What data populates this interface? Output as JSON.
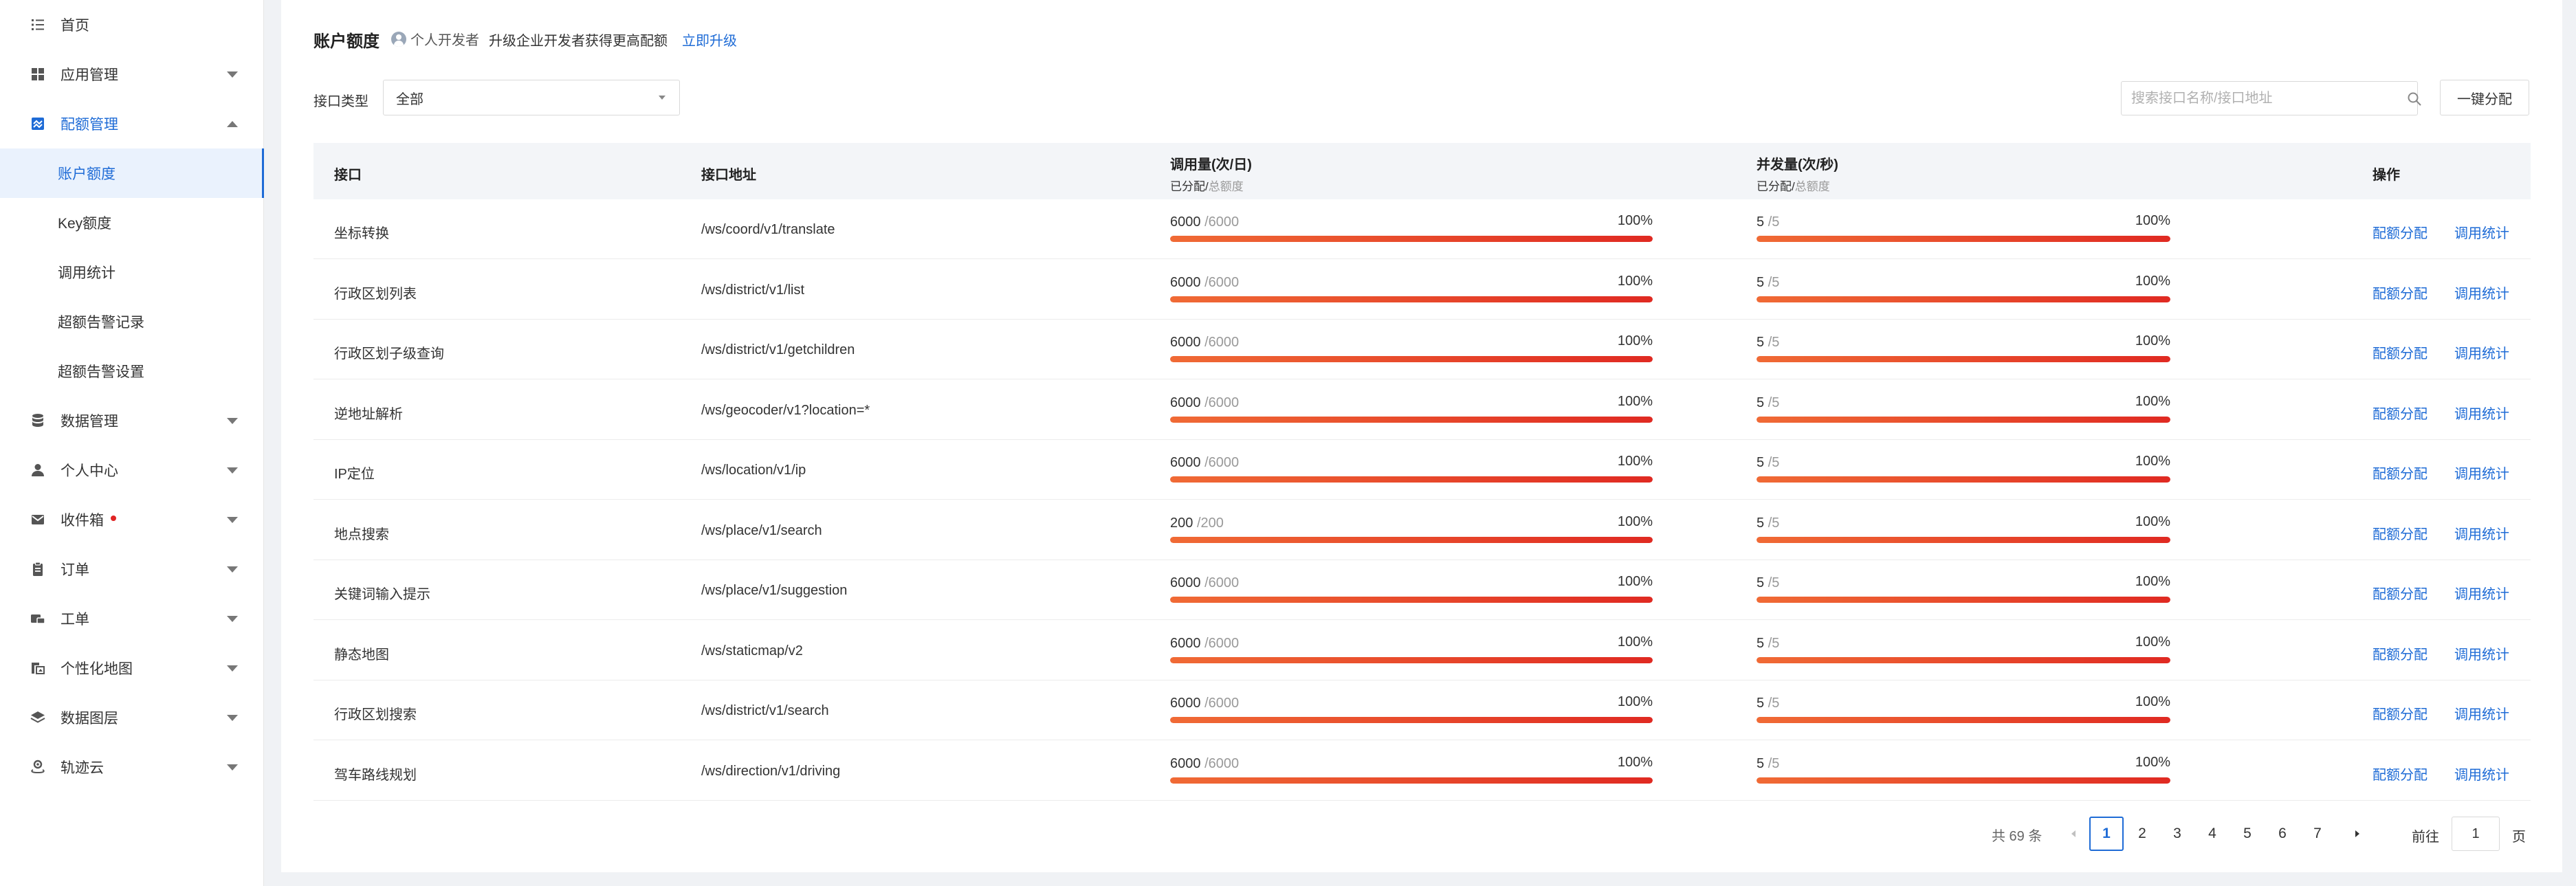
{
  "sidebar": {
    "items": [
      {
        "label": "首页",
        "icon": "list-icon",
        "arrow": "none",
        "state": "normal",
        "sub": false
      },
      {
        "label": "应用管理",
        "icon": "grid-icon",
        "arrow": "down",
        "state": "normal",
        "sub": false
      },
      {
        "label": "配额管理",
        "icon": "quota-icon",
        "arrow": "up",
        "state": "open",
        "sub": false
      },
      {
        "label": "账户额度",
        "icon": "",
        "arrow": "none",
        "state": "active",
        "sub": true
      },
      {
        "label": "Key额度",
        "icon": "",
        "arrow": "none",
        "state": "normal",
        "sub": true
      },
      {
        "label": "调用统计",
        "icon": "",
        "arrow": "none",
        "state": "normal",
        "sub": true
      },
      {
        "label": "超额告警记录",
        "icon": "",
        "arrow": "none",
        "state": "normal",
        "sub": true
      },
      {
        "label": "超额告警设置",
        "icon": "",
        "arrow": "none",
        "state": "normal",
        "sub": true
      },
      {
        "label": "数据管理",
        "icon": "database-icon",
        "arrow": "down",
        "state": "normal",
        "sub": false
      },
      {
        "label": "个人中心",
        "icon": "user-icon",
        "arrow": "down",
        "state": "normal",
        "sub": false
      },
      {
        "label": "收件箱",
        "icon": "mail-icon",
        "arrow": "down",
        "state": "normal",
        "sub": false,
        "dot": true
      },
      {
        "label": "订单",
        "icon": "clipboard-icon",
        "arrow": "down",
        "state": "normal",
        "sub": false
      },
      {
        "label": "工单",
        "icon": "ticket-icon",
        "arrow": "down",
        "state": "normal",
        "sub": false
      },
      {
        "label": "个性化地图",
        "icon": "map-style-icon",
        "arrow": "down",
        "state": "normal",
        "sub": false
      },
      {
        "label": "数据图层",
        "icon": "layers-icon",
        "arrow": "down",
        "state": "normal",
        "sub": false
      },
      {
        "label": "轨迹云",
        "icon": "track-icon",
        "arrow": "down",
        "state": "normal",
        "sub": false
      }
    ]
  },
  "header": {
    "title": "账户额度",
    "dev_badge": "个人开发者",
    "upgrade_text": "升级企业开发者获得更高配额",
    "upgrade_link": "立即升级"
  },
  "filters": {
    "type_label": "接口类型",
    "type_value": "全部",
    "search_placeholder": "搜索接口名称/接口地址",
    "alloc_all_label": "一键分配"
  },
  "table": {
    "columns": {
      "api": "接口",
      "address": "接口地址",
      "calls": "调用量(次/日)",
      "concurrency": "并发量(次/秒)",
      "ops": "操作",
      "sub_allocated": "已分配/",
      "sub_total": "总额度"
    },
    "rows": [
      {
        "name": "坐标转换",
        "address": "/ws/coord/v1/translate",
        "calls_used": "6000",
        "calls_total": "/6000",
        "calls_pct": "100%",
        "calls_ratio": 1,
        "conc_used": "5",
        "conc_total": "/5",
        "conc_pct": "100%",
        "conc_ratio": 1,
        "op1": "配额分配",
        "op2": "调用统计"
      },
      {
        "name": "行政区划列表",
        "address": "/ws/district/v1/list",
        "calls_used": "6000",
        "calls_total": "/6000",
        "calls_pct": "100%",
        "calls_ratio": 1,
        "conc_used": "5",
        "conc_total": "/5",
        "conc_pct": "100%",
        "conc_ratio": 1,
        "op1": "配额分配",
        "op2": "调用统计"
      },
      {
        "name": "行政区划子级查询",
        "address": "/ws/district/v1/getchildren",
        "calls_used": "6000",
        "calls_total": "/6000",
        "calls_pct": "100%",
        "calls_ratio": 1,
        "conc_used": "5",
        "conc_total": "/5",
        "conc_pct": "100%",
        "conc_ratio": 1,
        "op1": "配额分配",
        "op2": "调用统计"
      },
      {
        "name": "逆地址解析",
        "address": "/ws/geocoder/v1?location=*",
        "calls_used": "6000",
        "calls_total": "/6000",
        "calls_pct": "100%",
        "calls_ratio": 1,
        "conc_used": "5",
        "conc_total": "/5",
        "conc_pct": "100%",
        "conc_ratio": 1,
        "op1": "配额分配",
        "op2": "调用统计"
      },
      {
        "name": "IP定位",
        "address": "/ws/location/v1/ip",
        "calls_used": "6000",
        "calls_total": "/6000",
        "calls_pct": "100%",
        "calls_ratio": 1,
        "conc_used": "5",
        "conc_total": "/5",
        "conc_pct": "100%",
        "conc_ratio": 1,
        "op1": "配额分配",
        "op2": "调用统计"
      },
      {
        "name": "地点搜索",
        "address": "/ws/place/v1/search",
        "calls_used": "200",
        "calls_total": "/200",
        "calls_pct": "100%",
        "calls_ratio": 1,
        "conc_used": "5",
        "conc_total": "/5",
        "conc_pct": "100%",
        "conc_ratio": 1,
        "op1": "配额分配",
        "op2": "调用统计"
      },
      {
        "name": "关键词输入提示",
        "address": "/ws/place/v1/suggestion",
        "calls_used": "6000",
        "calls_total": "/6000",
        "calls_pct": "100%",
        "calls_ratio": 1,
        "conc_used": "5",
        "conc_total": "/5",
        "conc_pct": "100%",
        "conc_ratio": 1,
        "op1": "配额分配",
        "op2": "调用统计"
      },
      {
        "name": "静态地图",
        "address": "/ws/staticmap/v2",
        "calls_used": "6000",
        "calls_total": "/6000",
        "calls_pct": "100%",
        "calls_ratio": 1,
        "conc_used": "5",
        "conc_total": "/5",
        "conc_pct": "100%",
        "conc_ratio": 1,
        "op1": "配额分配",
        "op2": "调用统计"
      },
      {
        "name": "行政区划搜索",
        "address": "/ws/district/v1/search",
        "calls_used": "6000",
        "calls_total": "/6000",
        "calls_pct": "100%",
        "calls_ratio": 1,
        "conc_used": "5",
        "conc_total": "/5",
        "conc_pct": "100%",
        "conc_ratio": 1,
        "op1": "配额分配",
        "op2": "调用统计"
      },
      {
        "name": "驾车路线规划",
        "address": "/ws/direction/v1/driving",
        "calls_used": "6000",
        "calls_total": "/6000",
        "calls_pct": "100%",
        "calls_ratio": 1,
        "conc_used": "5",
        "conc_total": "/5",
        "conc_pct": "100%",
        "conc_ratio": 1,
        "op1": "配额分配",
        "op2": "调用统计"
      }
    ]
  },
  "pagination": {
    "total_text": "共 69 条",
    "pages": [
      "1",
      "2",
      "3",
      "4",
      "5",
      "6",
      "7"
    ],
    "current": "1",
    "goto_label": "前往",
    "goto_value": "1",
    "page_unit": "页"
  },
  "colors": {
    "accent": "#1e6bd6",
    "bar_start": "#f06a35",
    "bar_end": "#e02a22",
    "badge_dot": "#e02424"
  }
}
